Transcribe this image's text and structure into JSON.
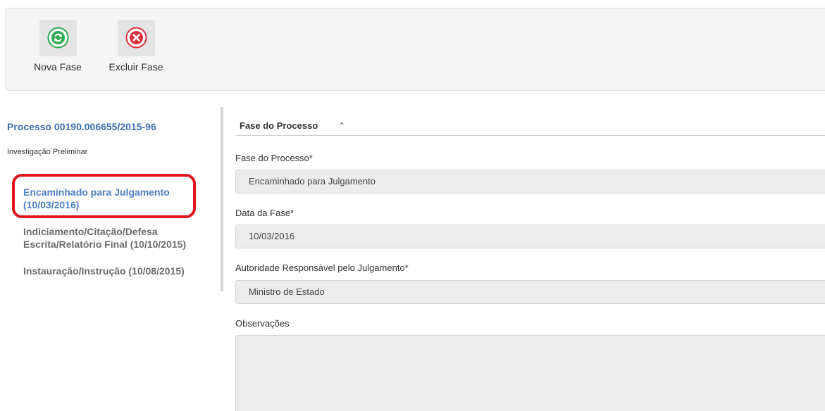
{
  "toolbar": {
    "buttons": [
      {
        "label": "Nova Fase",
        "icon": "refresh-icon",
        "color": "#2fa84f"
      },
      {
        "label": "Excluir Fase",
        "icon": "close-icon",
        "color": "#d9303e"
      }
    ]
  },
  "sidebar": {
    "process_link": "Processo 00190.006655/2015-96",
    "process_type": "Investigação Preliminar",
    "phases": [
      {
        "name": "Encaminhado para Julgamento",
        "date": "(10/03/2016)",
        "active": true
      },
      {
        "name": "Indiciamento/Citação/Defesa Escrita/Relatório Final",
        "date": "(10/10/2015)",
        "active": false
      },
      {
        "name": "Instauração/Instrução",
        "date": "(10/08/2015)",
        "active": false
      }
    ],
    "highlight_color": "#e0141e"
  },
  "main": {
    "section_title": "Fase do Processo",
    "fields": {
      "fase": {
        "label": "Fase do Processo*",
        "value": "Encaminhado para Julgamento"
      },
      "data": {
        "label": "Data da Fase*",
        "value": "10/03/2016"
      },
      "autoridade": {
        "label": "Autoridade Responsável pelo Julgamento*",
        "value": "Ministro de Estado"
      },
      "observacoes": {
        "label": "Observações",
        "value": ""
      }
    }
  }
}
